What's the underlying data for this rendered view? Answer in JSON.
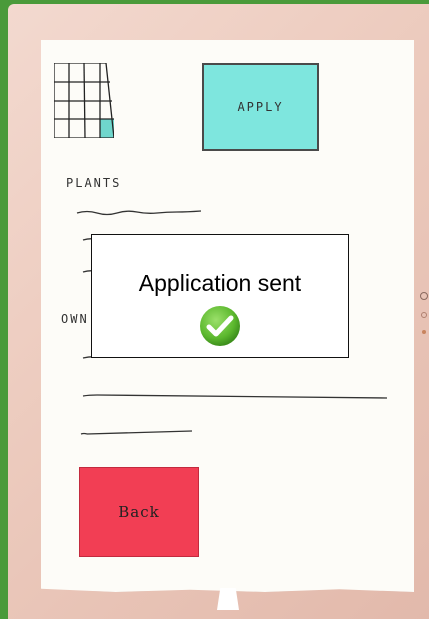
{
  "screen": {
    "apply_label": "APPLY",
    "plants_label": "PLANTS",
    "owner_label": "OWN",
    "back_label": "Back",
    "dialog_message": "Application sent"
  },
  "colors": {
    "apply_bg": "#7ee6de",
    "back_bg": "#f23e54",
    "check_green": "#5cb82e",
    "frame_green": "#4a9a3a"
  },
  "icons": {
    "grid": "grid-sketch-icon",
    "check": "checkmark-icon"
  }
}
